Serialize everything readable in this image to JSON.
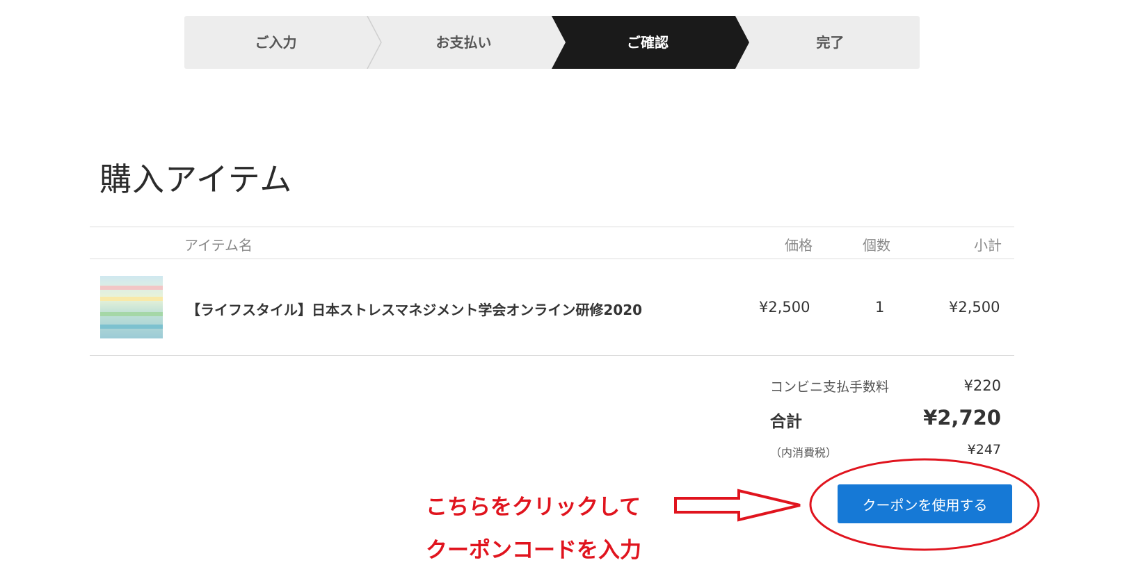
{
  "steps": [
    {
      "label": "ご入力",
      "active": false
    },
    {
      "label": "お支払い",
      "active": false
    },
    {
      "label": "ご確認",
      "active": true
    },
    {
      "label": "完了",
      "active": false
    }
  ],
  "section_title": "購入アイテム",
  "table": {
    "headers": {
      "name": "アイテム名",
      "price": "価格",
      "qty": "個数",
      "subtotal": "小計"
    },
    "rows": [
      {
        "name": "【ライフスタイル】日本ストレスマネジメント学会オンライン研修2020",
        "price": "¥2,500",
        "qty": "1",
        "subtotal": "¥2,500"
      }
    ]
  },
  "summary": {
    "fee_label": "コンビニ支払手数料",
    "fee_value": "¥220",
    "total_label": "合計",
    "total_value": "¥2,720",
    "tax_label": "（内消費税）",
    "tax_value": "¥247"
  },
  "coupon_button": "クーポンを使用する",
  "annotation": {
    "line1": "こちらをクリックして",
    "line2": "クーポンコードを入力",
    "color": "#e0141e"
  },
  "colors": {
    "active_step": "#1a1a1a",
    "button": "#1679d6"
  }
}
